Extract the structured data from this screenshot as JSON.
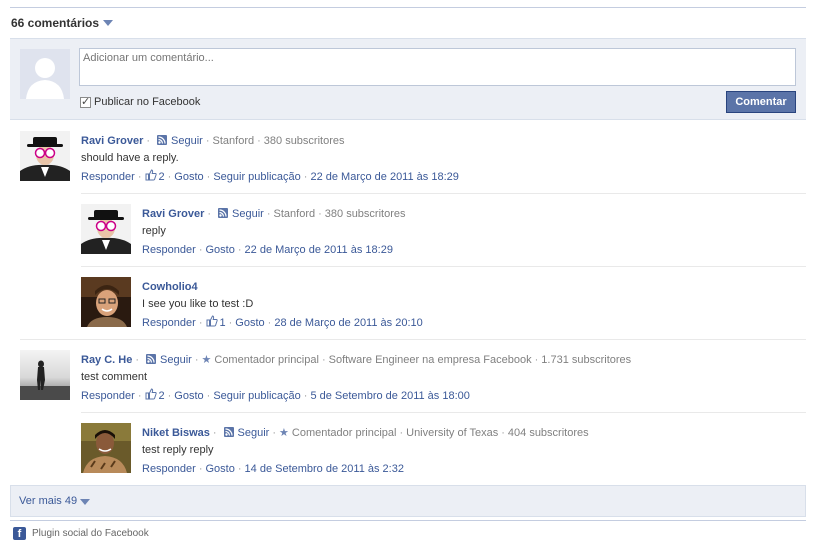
{
  "header": {
    "count_label": "66 comentários"
  },
  "composer": {
    "placeholder": "Adicionar um comentário...",
    "publish_label": "Publicar no Facebook",
    "publish_checked": true,
    "submit_label": "Comentar"
  },
  "comments": [
    {
      "name": "Ravi Grover",
      "follow": "Seguir",
      "org": "Stanford",
      "subscribers": "380 subscritores",
      "text": "should have a reply.",
      "reply": "Responder",
      "likes": "2",
      "like_label": "Gosto",
      "follow_post": "Seguir publicação",
      "time": "22 de Março de 2011 às 18:29"
    },
    {
      "name": "Ravi Grover",
      "follow": "Seguir",
      "org": "Stanford",
      "subscribers": "380 subscritores",
      "text": "reply",
      "reply": "Responder",
      "like_label": "Gosto",
      "time": "22 de Março de 2011 às 18:29"
    },
    {
      "name": "Cowholio4",
      "text": "I see you like to test :D",
      "reply": "Responder",
      "likes": "1",
      "like_label": "Gosto",
      "time": "28 de Março de 2011 às 20:10"
    },
    {
      "name": "Ray C. He",
      "follow": "Seguir",
      "badge": "Comentador principal",
      "org": "Software Engineer na empresa Facebook",
      "subscribers": "1.731 subscritores",
      "text": "test comment",
      "reply": "Responder",
      "likes": "2",
      "like_label": "Gosto",
      "follow_post": "Seguir publicação",
      "time": "5 de Setembro de 2011 às 18:00"
    },
    {
      "name": "Niket Biswas",
      "follow": "Seguir",
      "badge": "Comentador principal",
      "org": "University of Texas",
      "subscribers": "404 subscritores",
      "text": "test reply reply",
      "reply": "Responder",
      "like_label": "Gosto",
      "time": "14 de Setembro de 2011 às 2:32"
    }
  ],
  "more": {
    "label": "Ver mais 49"
  },
  "footer": {
    "label": "Plugin social do Facebook"
  },
  "colors": {
    "link": "#3b5998",
    "button": "#5b74a8",
    "panel": "#eceff5"
  },
  "icons": [
    "caret-down-icon",
    "rss-icon",
    "thumb-up-icon",
    "star-icon",
    "facebook-logo-icon",
    "checkbox-checked-icon"
  ]
}
